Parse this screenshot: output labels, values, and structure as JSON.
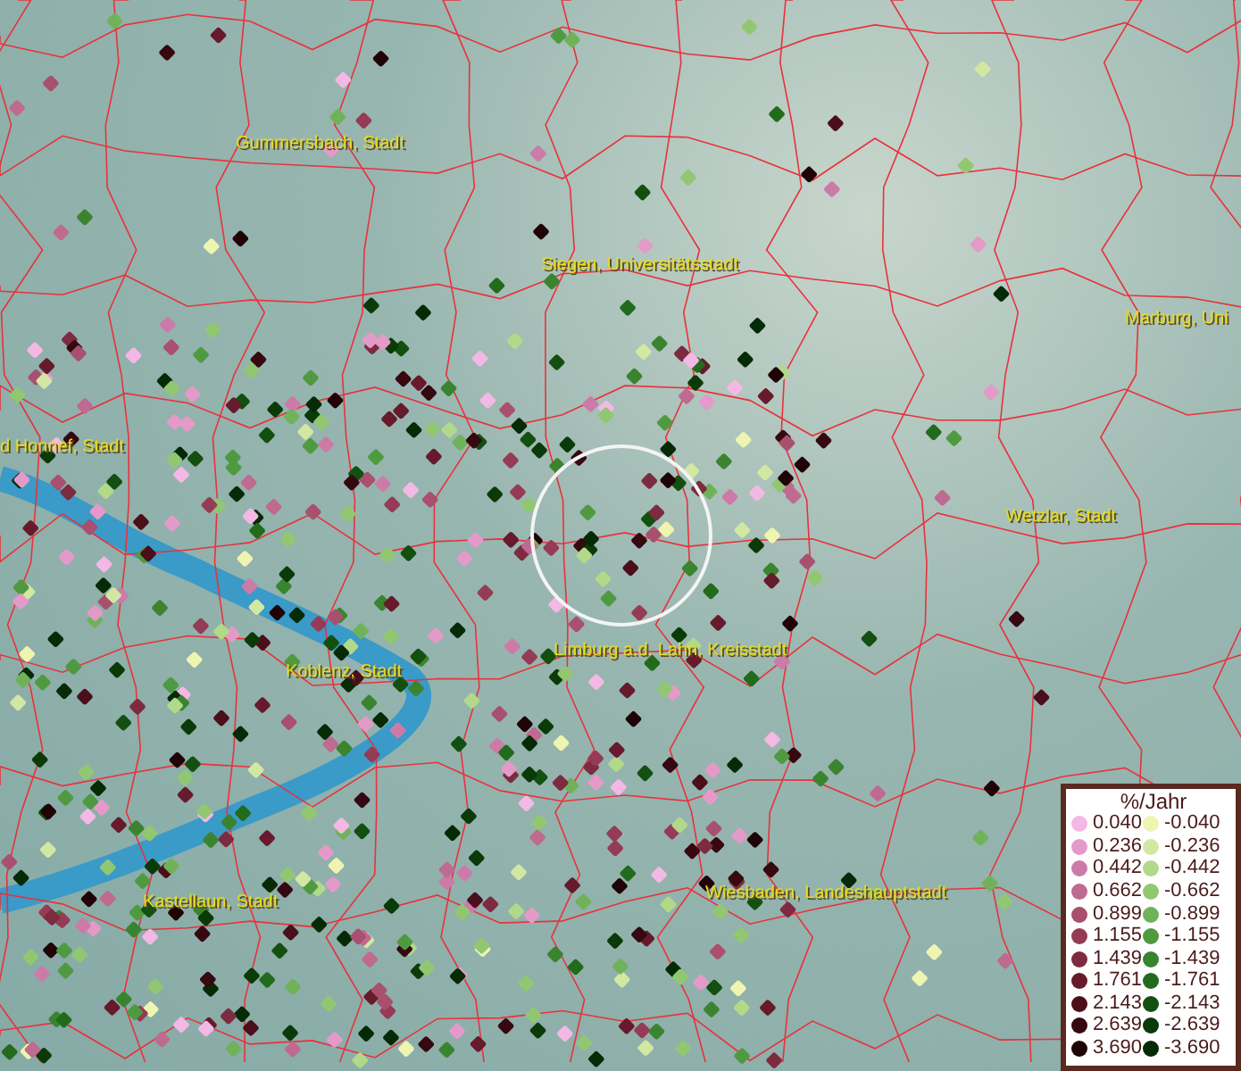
{
  "map": {
    "places": [
      {
        "label": "Gummersbach, Stadt"
      },
      {
        "label": "Siegen, Universitätsstadt"
      },
      {
        "label": "Marburg, Uni"
      },
      {
        "label": "d Honnef, Stadt"
      },
      {
        "label": "Wetzlar, Stadt"
      },
      {
        "label": "Limburg a.d. Lahn, Kreisstadt"
      },
      {
        "label": "Koblenz, Stadt"
      },
      {
        "label": "Wiesbaden, Landeshauptstadt"
      },
      {
        "label": "Kastellaun, Stadt"
      }
    ]
  },
  "legend": {
    "title": "%/Jahr",
    "items": [
      {
        "label": "0.040",
        "color": "#f4b8e4"
      },
      {
        "label": "-0.040",
        "color": "#eef5b0"
      },
      {
        "label": "0.236",
        "color": "#e49ac8"
      },
      {
        "label": "-0.236",
        "color": "#d2e8a2"
      },
      {
        "label": "0.442",
        "color": "#cc7ba8"
      },
      {
        "label": "-0.442",
        "color": "#b2d98a"
      },
      {
        "label": "0.662",
        "color": "#bf6a90"
      },
      {
        "label": "-0.662",
        "color": "#92c772"
      },
      {
        "label": "0.899",
        "color": "#a8506e"
      },
      {
        "label": "-0.899",
        "color": "#70b25a"
      },
      {
        "label": "1.155",
        "color": "#953b55"
      },
      {
        "label": "-1.155",
        "color": "#4f9a40"
      },
      {
        "label": "1.439",
        "color": "#7d2b40"
      },
      {
        "label": "-1.439",
        "color": "#3a8430"
      },
      {
        "label": "1.761",
        "color": "#661a2c"
      },
      {
        "label": "-1.761",
        "color": "#236b1c"
      },
      {
        "label": "2.143",
        "color": "#4a0f1a"
      },
      {
        "label": "-2.143",
        "color": "#135010"
      },
      {
        "label": "2.639",
        "color": "#360810"
      },
      {
        "label": "-2.639",
        "color": "#0a3a08"
      },
      {
        "label": "3.690",
        "color": "#200306"
      },
      {
        "label": "-3.690",
        "color": "#062a05"
      }
    ]
  }
}
